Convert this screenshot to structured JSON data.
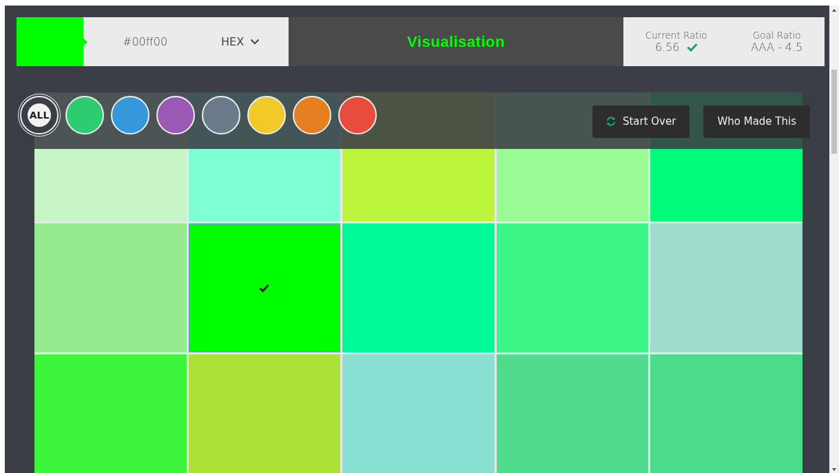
{
  "color_input": {
    "value": "#00ff00",
    "format": "HEX"
  },
  "title": "Visualisation",
  "ratios": [
    {
      "label": "Current Ratio",
      "value": "6.56",
      "passed": true
    },
    {
      "label": "Goal Ratio",
      "value": "AAA - 4.5",
      "passed": false
    }
  ],
  "filters": [
    {
      "kind": "all",
      "label": "ALL",
      "selected": true
    },
    {
      "kind": "color",
      "color": "#2ecc71",
      "selected": false
    },
    {
      "kind": "color",
      "color": "#3498db",
      "selected": false
    },
    {
      "kind": "color",
      "color": "#9b59b6",
      "selected": false
    },
    {
      "kind": "color",
      "color": "#6b7a8a",
      "selected": false
    },
    {
      "kind": "color",
      "color": "#f1ca2a",
      "selected": false
    },
    {
      "kind": "color",
      "color": "#e67e22",
      "selected": false
    },
    {
      "kind": "color",
      "color": "#e74c3c",
      "selected": false
    }
  ],
  "buttons": [
    {
      "kind": "refresh",
      "label": "Start Over"
    },
    {
      "kind": "plain",
      "label": "Who Made This"
    }
  ],
  "grid": {
    "rows": [
      {
        "cells": [
          {
            "color": "#c8f5c8",
            "selected": false
          },
          {
            "color": "#7fffd4",
            "selected": false
          },
          {
            "color": "#bbf53c",
            "selected": false
          },
          {
            "color": "#9afa96",
            "selected": false
          },
          {
            "color": "#00fa7a",
            "selected": false
          }
        ]
      },
      {
        "cells": [
          {
            "color": "#96eb91",
            "selected": false
          },
          {
            "color": "#00ff00",
            "selected": true
          },
          {
            "color": "#00fa9a",
            "selected": false
          },
          {
            "color": "#3cf587",
            "selected": false
          },
          {
            "color": "#a0dccd",
            "selected": false
          }
        ]
      },
      {
        "cells": [
          {
            "color": "#3cf53c",
            "selected": false
          },
          {
            "color": "#aae236",
            "selected": false
          },
          {
            "color": "#87e0d2",
            "selected": false
          },
          {
            "color": "#50dc8c",
            "selected": false
          },
          {
            "color": "#4bdc8c",
            "selected": false
          }
        ]
      }
    ]
  }
}
